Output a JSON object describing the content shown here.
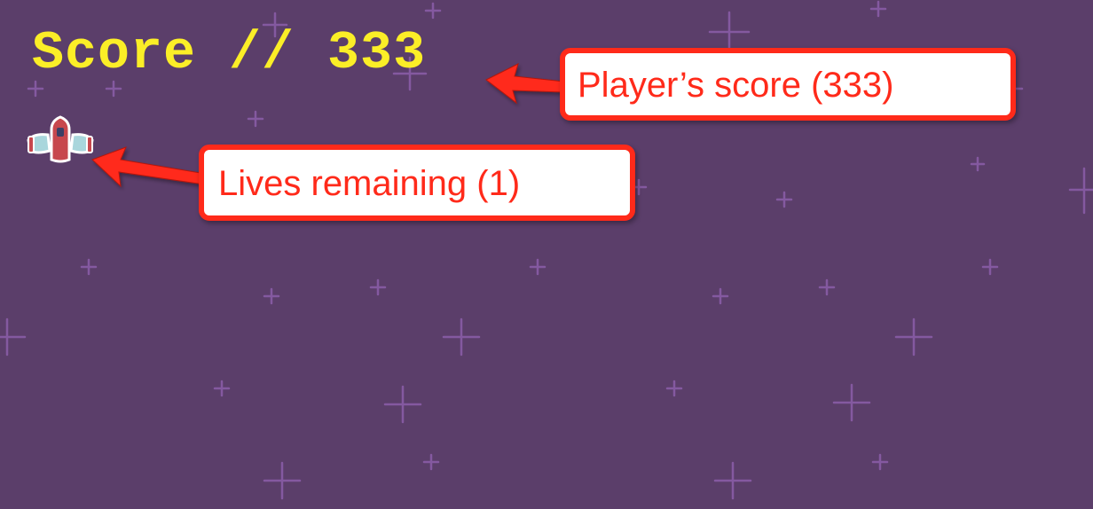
{
  "hud": {
    "score_text": "Score // 333",
    "score_color": "#fbee27",
    "lives_icon": "player-ship-icon"
  },
  "annotations": {
    "score_callout": "Player’s score (333)",
    "lives_callout": "Lives remaining (1)",
    "callout_color": "#ff2a1a"
  },
  "background": {
    "color": "#5b3e6a",
    "star_color": "#8a62a4"
  }
}
